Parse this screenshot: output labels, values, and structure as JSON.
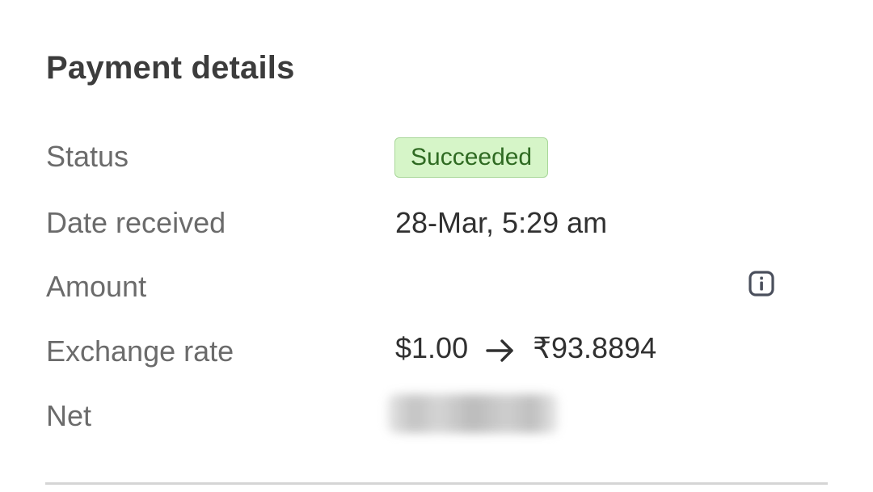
{
  "panel": {
    "title": "Payment details"
  },
  "rows": {
    "status": {
      "label": "Status",
      "value": "Succeeded"
    },
    "date_received": {
      "label": "Date received",
      "value": "28-Mar, 5:29 am"
    },
    "amount": {
      "label": "Amount",
      "icon": "info-icon"
    },
    "exchange_rate": {
      "label": "Exchange rate",
      "from": "$1.00",
      "to": "₹93.8894",
      "arrow_icon": "arrow-right-icon"
    },
    "net": {
      "label": "Net",
      "value_state": "blurred"
    }
  },
  "colors": {
    "badge_background": "#d6f5c8",
    "badge_border": "#a9d79a",
    "badge_text": "#2f6a22",
    "label_text": "#6b6b6b",
    "value_text": "#303030"
  }
}
